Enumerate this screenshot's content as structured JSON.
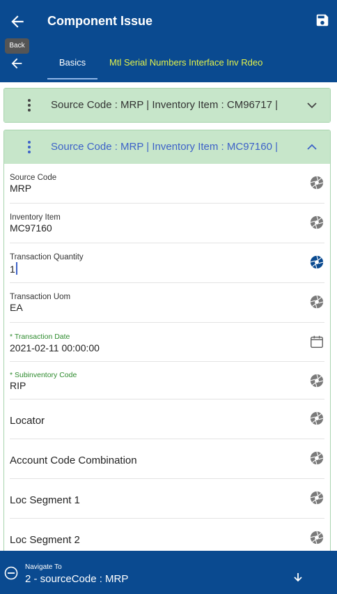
{
  "header": {
    "title": "Component Issue",
    "back_tooltip": "Back"
  },
  "tabs": [
    {
      "label": "Basics"
    },
    {
      "label": "Mtl Serial Numbers Interface Inv Rdeo"
    }
  ],
  "cards": [
    {
      "summary": "Source Code  : MRP | Inventory Item  : CM96717 |",
      "expanded": false
    },
    {
      "summary": "Source Code  : MRP | Inventory Item  : MC97160 |",
      "expanded": true
    }
  ],
  "fields": [
    {
      "label": "Source Code",
      "value": "MRP",
      "icon": "aperture-icon"
    },
    {
      "label": "Inventory Item",
      "value": "MC97160",
      "icon": "aperture-icon"
    },
    {
      "label": "Transaction Quantity",
      "value": "1",
      "icon": "aperture-icon"
    },
    {
      "label": "Transaction Uom",
      "value": "EA",
      "icon": "aperture-icon"
    },
    {
      "label": "* Transaction Date",
      "value": "2021-02-11 00:00:00",
      "icon": "calendar-icon"
    },
    {
      "label": "* Subinventory Code",
      "value": "RIP",
      "icon": "aperture-icon"
    },
    {
      "label": "Locator",
      "icon": "aperture-icon"
    },
    {
      "label": "Account Code Combination",
      "icon": "aperture-icon"
    },
    {
      "label": "Loc Segment 1",
      "icon": "aperture-icon"
    },
    {
      "label": "Loc Segment 2",
      "icon": "aperture-icon"
    }
  ],
  "footer": {
    "label": "Navigate To",
    "value": "2 - sourceCode : MRP"
  },
  "colors": {
    "primary": "#0a4a90",
    "card_header": "#c7e6ca",
    "active_tab_text": "#e3f24a",
    "required_label": "#2e8b2e",
    "link_blue": "#3d62c8"
  }
}
